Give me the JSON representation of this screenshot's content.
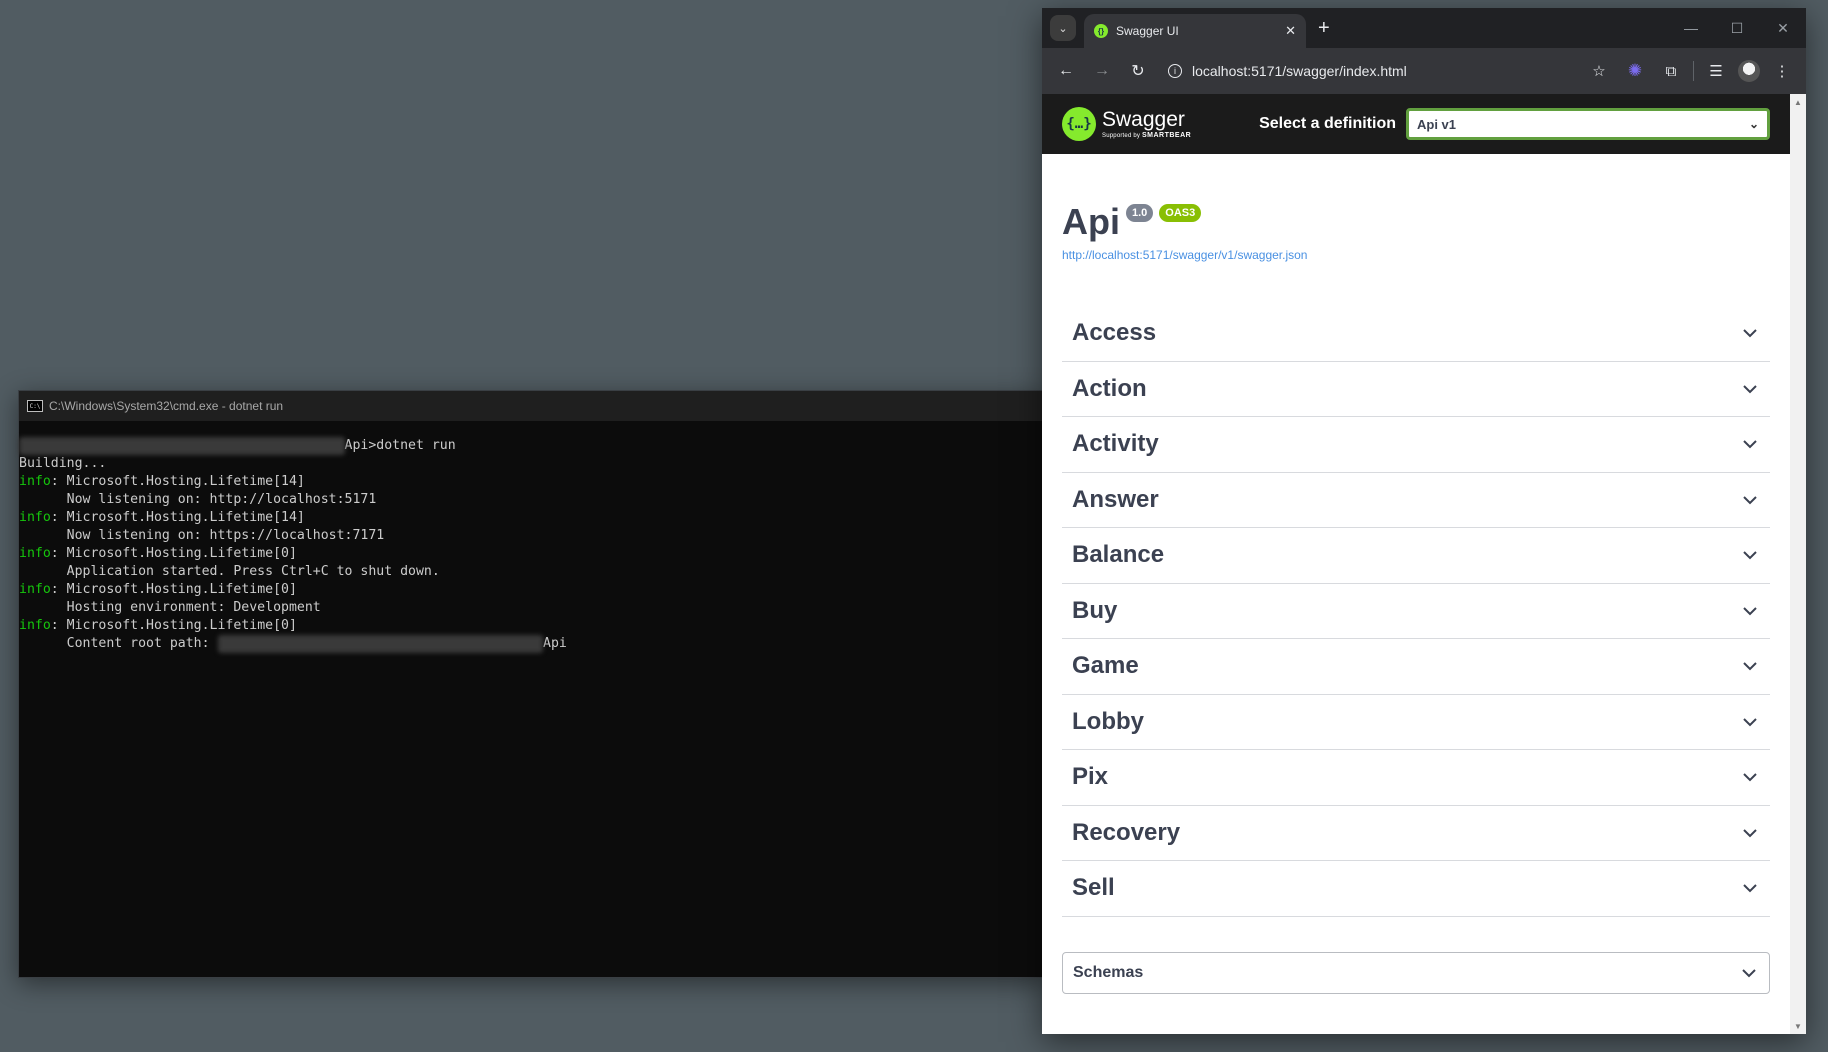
{
  "cmd": {
    "title": "C:\\Windows\\System32\\cmd.exe - dotnet  run",
    "icon": "C:\\",
    "lines": [
      {
        "blur": "D:\\Clients\\Redacted\\Projects\\Application\\",
        "text": "Api>dotnet run"
      },
      {
        "text": "Building..."
      },
      {
        "prefix": "info",
        "text": ": Microsoft.Hosting.Lifetime[14]"
      },
      {
        "text": "      Now listening on: http://localhost:5171"
      },
      {
        "prefix": "info",
        "text": ": Microsoft.Hosting.Lifetime[14]"
      },
      {
        "text": "      Now listening on: https://localhost:7171"
      },
      {
        "prefix": "info",
        "text": ": Microsoft.Hosting.Lifetime[0]"
      },
      {
        "text": "      Application started. Press Ctrl+C to shut down."
      },
      {
        "prefix": "info",
        "text": ": Microsoft.Hosting.Lifetime[0]"
      },
      {
        "text": "      Hosting environment: Development"
      },
      {
        "prefix": "info",
        "text": ": Microsoft.Hosting.Lifetime[0]"
      },
      {
        "text": "      Content root path: ",
        "blur": "D:\\Clients\\Redacted\\Projects\\Application\\",
        "after": "Api"
      }
    ]
  },
  "browser": {
    "tab_title": "Swagger UI",
    "url": "localhost:5171/swagger/index.html",
    "window_controls": [
      "—",
      "☐",
      "✕"
    ]
  },
  "swagger": {
    "logo_name": "Swagger",
    "logo_sub_prefix": "Supported by ",
    "logo_sub_brand": "SMARTBEAR",
    "definition_label": "Select a definition",
    "definition_value": "Api v1",
    "api_title": "Api",
    "version_badge": "1.0",
    "oas_badge": "OAS3",
    "spec_url": "http://localhost:5171/swagger/v1/swagger.json",
    "tags": [
      "Access",
      "Action",
      "Activity",
      "Answer",
      "Balance",
      "Buy",
      "Game",
      "Lobby",
      "Pix",
      "Recovery",
      "Sell"
    ],
    "schemas_label": "Schemas"
  },
  "colors": {
    "desktop": "#515c62",
    "swagger_green": "#85ea2d",
    "info_green": "#16c60c",
    "link_blue": "#4990e2",
    "text_dark": "#3b4151"
  }
}
